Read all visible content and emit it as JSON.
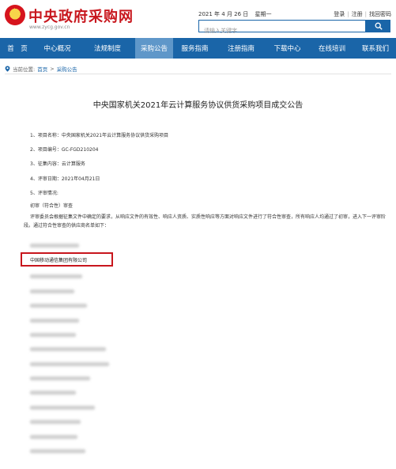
{
  "header": {
    "site_title": "中央政府采购网",
    "site_url": "www.zycg.gov.cn",
    "date": "2021 年 4 月 26 日",
    "weekday": "星期一",
    "links": [
      "登录",
      "注册",
      "找回密码"
    ],
    "search_placeholder": "请输入关键字"
  },
  "nav": {
    "items": [
      "首　页",
      "中心概况",
      "法规制度",
      "采购公告",
      "服务指南",
      "注册指南",
      "下载中心",
      "在线培训",
      "联系我们"
    ],
    "active_index": 3
  },
  "breadcrumb": {
    "label": "当前位置:",
    "home": "首页",
    "sep": ">",
    "current": "采购公告"
  },
  "article": {
    "title": "中央国家机关2021年云计算服务协议供货采购项目成交公告",
    "fields": [
      {
        "label": "1、项目名称：",
        "value": "中央国家机关2021年云计算服务协议供货采购项目"
      },
      {
        "label": "2、项目编号：",
        "value": "GC-FGD210204"
      },
      {
        "label": "3、征集内容：",
        "value": "云计算服务"
      },
      {
        "label": "4、评审日期：",
        "value": "2021年04月21日"
      },
      {
        "label": "5、评审情况:",
        "value": ""
      }
    ],
    "section_title": "初审（符合性）审查",
    "paragraph": "评审委员会根据征集文件中确定的要求，从响应文件的有效性、响应人资质、实质性响应等方面对响应文件进行了符合性审查，所有响应人均通过了初审，进入下一评审阶段。通过符合性审查的供应商名单如下：",
    "highlighted_supplier": "中国移动通信集团有限公司"
  },
  "colors": {
    "brand_red": "#c8161d",
    "nav_blue": "#1a65a8",
    "nav_active": "#5f97c9"
  }
}
